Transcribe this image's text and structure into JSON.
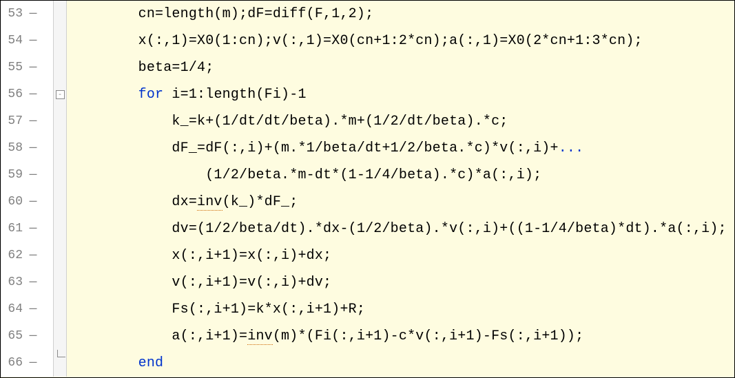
{
  "editor": {
    "lines": [
      {
        "number": "53",
        "dash": "—",
        "fold": "",
        "segments": [
          {
            "cls": "",
            "text": "        cn=length(m);dF=diff(F,1,2);"
          }
        ]
      },
      {
        "number": "54",
        "dash": "—",
        "fold": "",
        "segments": [
          {
            "cls": "",
            "text": "        x(:,1)=X0(1:cn);v(:,1)=X0(cn+1:2*cn);a(:,1)=X0(2*cn+1:3*cn);"
          }
        ]
      },
      {
        "number": "55",
        "dash": "—",
        "fold": "",
        "segments": [
          {
            "cls": "",
            "text": "        beta=1/4;"
          }
        ]
      },
      {
        "number": "56",
        "dash": "—",
        "fold": "minus",
        "segments": [
          {
            "cls": "",
            "text": "        "
          },
          {
            "cls": "kw",
            "text": "for"
          },
          {
            "cls": "",
            "text": " i=1:length(Fi)-1"
          }
        ]
      },
      {
        "number": "57",
        "dash": "—",
        "fold": "",
        "segments": [
          {
            "cls": "",
            "text": "            k_=k+(1/dt/dt/beta).*m+(1/2/dt/beta).*c;"
          }
        ]
      },
      {
        "number": "58",
        "dash": "—",
        "fold": "",
        "segments": [
          {
            "cls": "",
            "text": "            dF_=dF(:,i)+(m.*1/beta/dt+1/2/beta.*c)*v(:,i)+"
          },
          {
            "cls": "cont",
            "text": "..."
          }
        ]
      },
      {
        "number": "59",
        "dash": "—",
        "fold": "",
        "segments": [
          {
            "cls": "",
            "text": "                (1/2/beta.*m-dt*(1-1/4/beta).*c)*a(:,i);"
          }
        ]
      },
      {
        "number": "60",
        "dash": "—",
        "fold": "",
        "segments": [
          {
            "cls": "",
            "text": "            dx="
          },
          {
            "cls": "warn",
            "text": "inv"
          },
          {
            "cls": "",
            "text": "(k_)*dF_;"
          }
        ]
      },
      {
        "number": "61",
        "dash": "—",
        "fold": "",
        "segments": [
          {
            "cls": "",
            "text": "            dv=(1/2/beta/dt).*dx-(1/2/beta).*v(:,i)+((1-1/4/beta)*dt).*a(:,i);"
          }
        ]
      },
      {
        "number": "62",
        "dash": "—",
        "fold": "",
        "segments": [
          {
            "cls": "",
            "text": "            x(:,i+1)=x(:,i)+dx;"
          }
        ]
      },
      {
        "number": "63",
        "dash": "—",
        "fold": "",
        "segments": [
          {
            "cls": "",
            "text": "            v(:,i+1)=v(:,i)+dv;"
          }
        ]
      },
      {
        "number": "64",
        "dash": "—",
        "fold": "",
        "segments": [
          {
            "cls": "",
            "text": "            Fs(:,i+1)=k*x(:,i+1)+R;"
          }
        ]
      },
      {
        "number": "65",
        "dash": "—",
        "fold": "",
        "segments": [
          {
            "cls": "",
            "text": "            a(:,i+1)="
          },
          {
            "cls": "warn",
            "text": "inv"
          },
          {
            "cls": "",
            "text": "(m)*(Fi(:,i+1)-c*v(:,i+1)-Fs(:,i+1));"
          }
        ]
      },
      {
        "number": "66",
        "dash": "—",
        "fold": "end",
        "segments": [
          {
            "cls": "",
            "text": "        "
          },
          {
            "cls": "kw",
            "text": "end"
          }
        ]
      }
    ]
  }
}
